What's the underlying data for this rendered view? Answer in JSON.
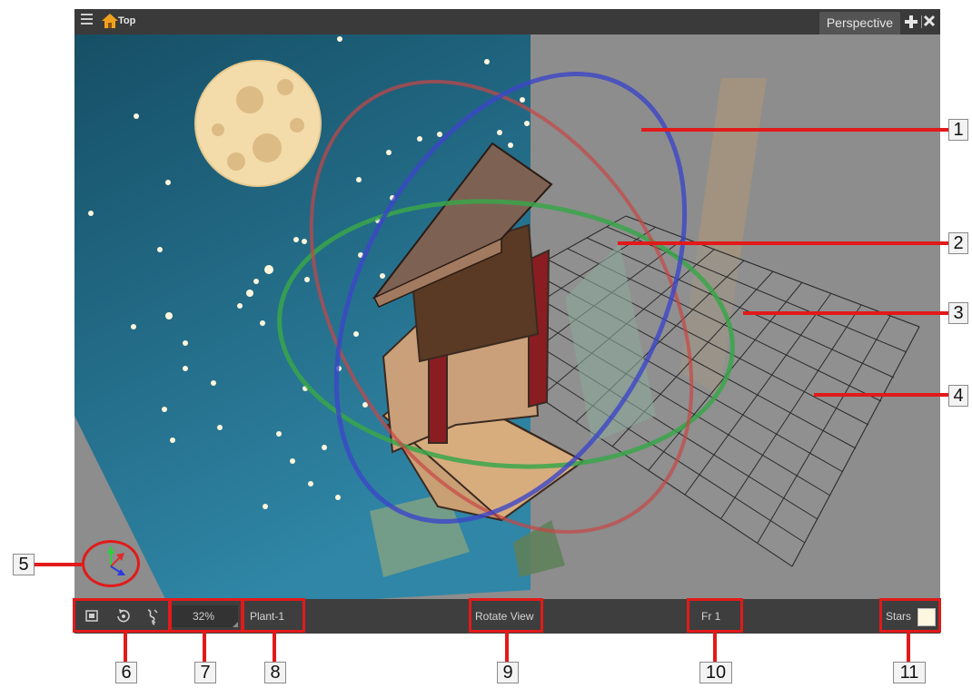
{
  "window": {
    "title": "Top",
    "view_tab": "Perspective",
    "icons": [
      "menu-icon",
      "home-icon",
      "add-view-icon",
      "close-icon"
    ]
  },
  "status_bar": {
    "buttons": [
      "reset-view-icon",
      "reset-rotation-icon",
      "toggle-quality-icon"
    ],
    "zoom": "32%",
    "layer": "Plant-1",
    "tool": "Rotate View",
    "frame": "Fr 1",
    "background_label": "Stars",
    "background_color": "#fcf7de"
  },
  "callouts": [
    "1",
    "2",
    "3",
    "4",
    "5",
    "6",
    "7",
    "8",
    "9",
    "10",
    "11"
  ],
  "colors": {
    "highlight": "#e21a1a",
    "sky": "#1f5f78",
    "rotate_red": "#c84646",
    "rotate_green": "#3aa64a",
    "rotate_blue": "#3c46c8"
  }
}
